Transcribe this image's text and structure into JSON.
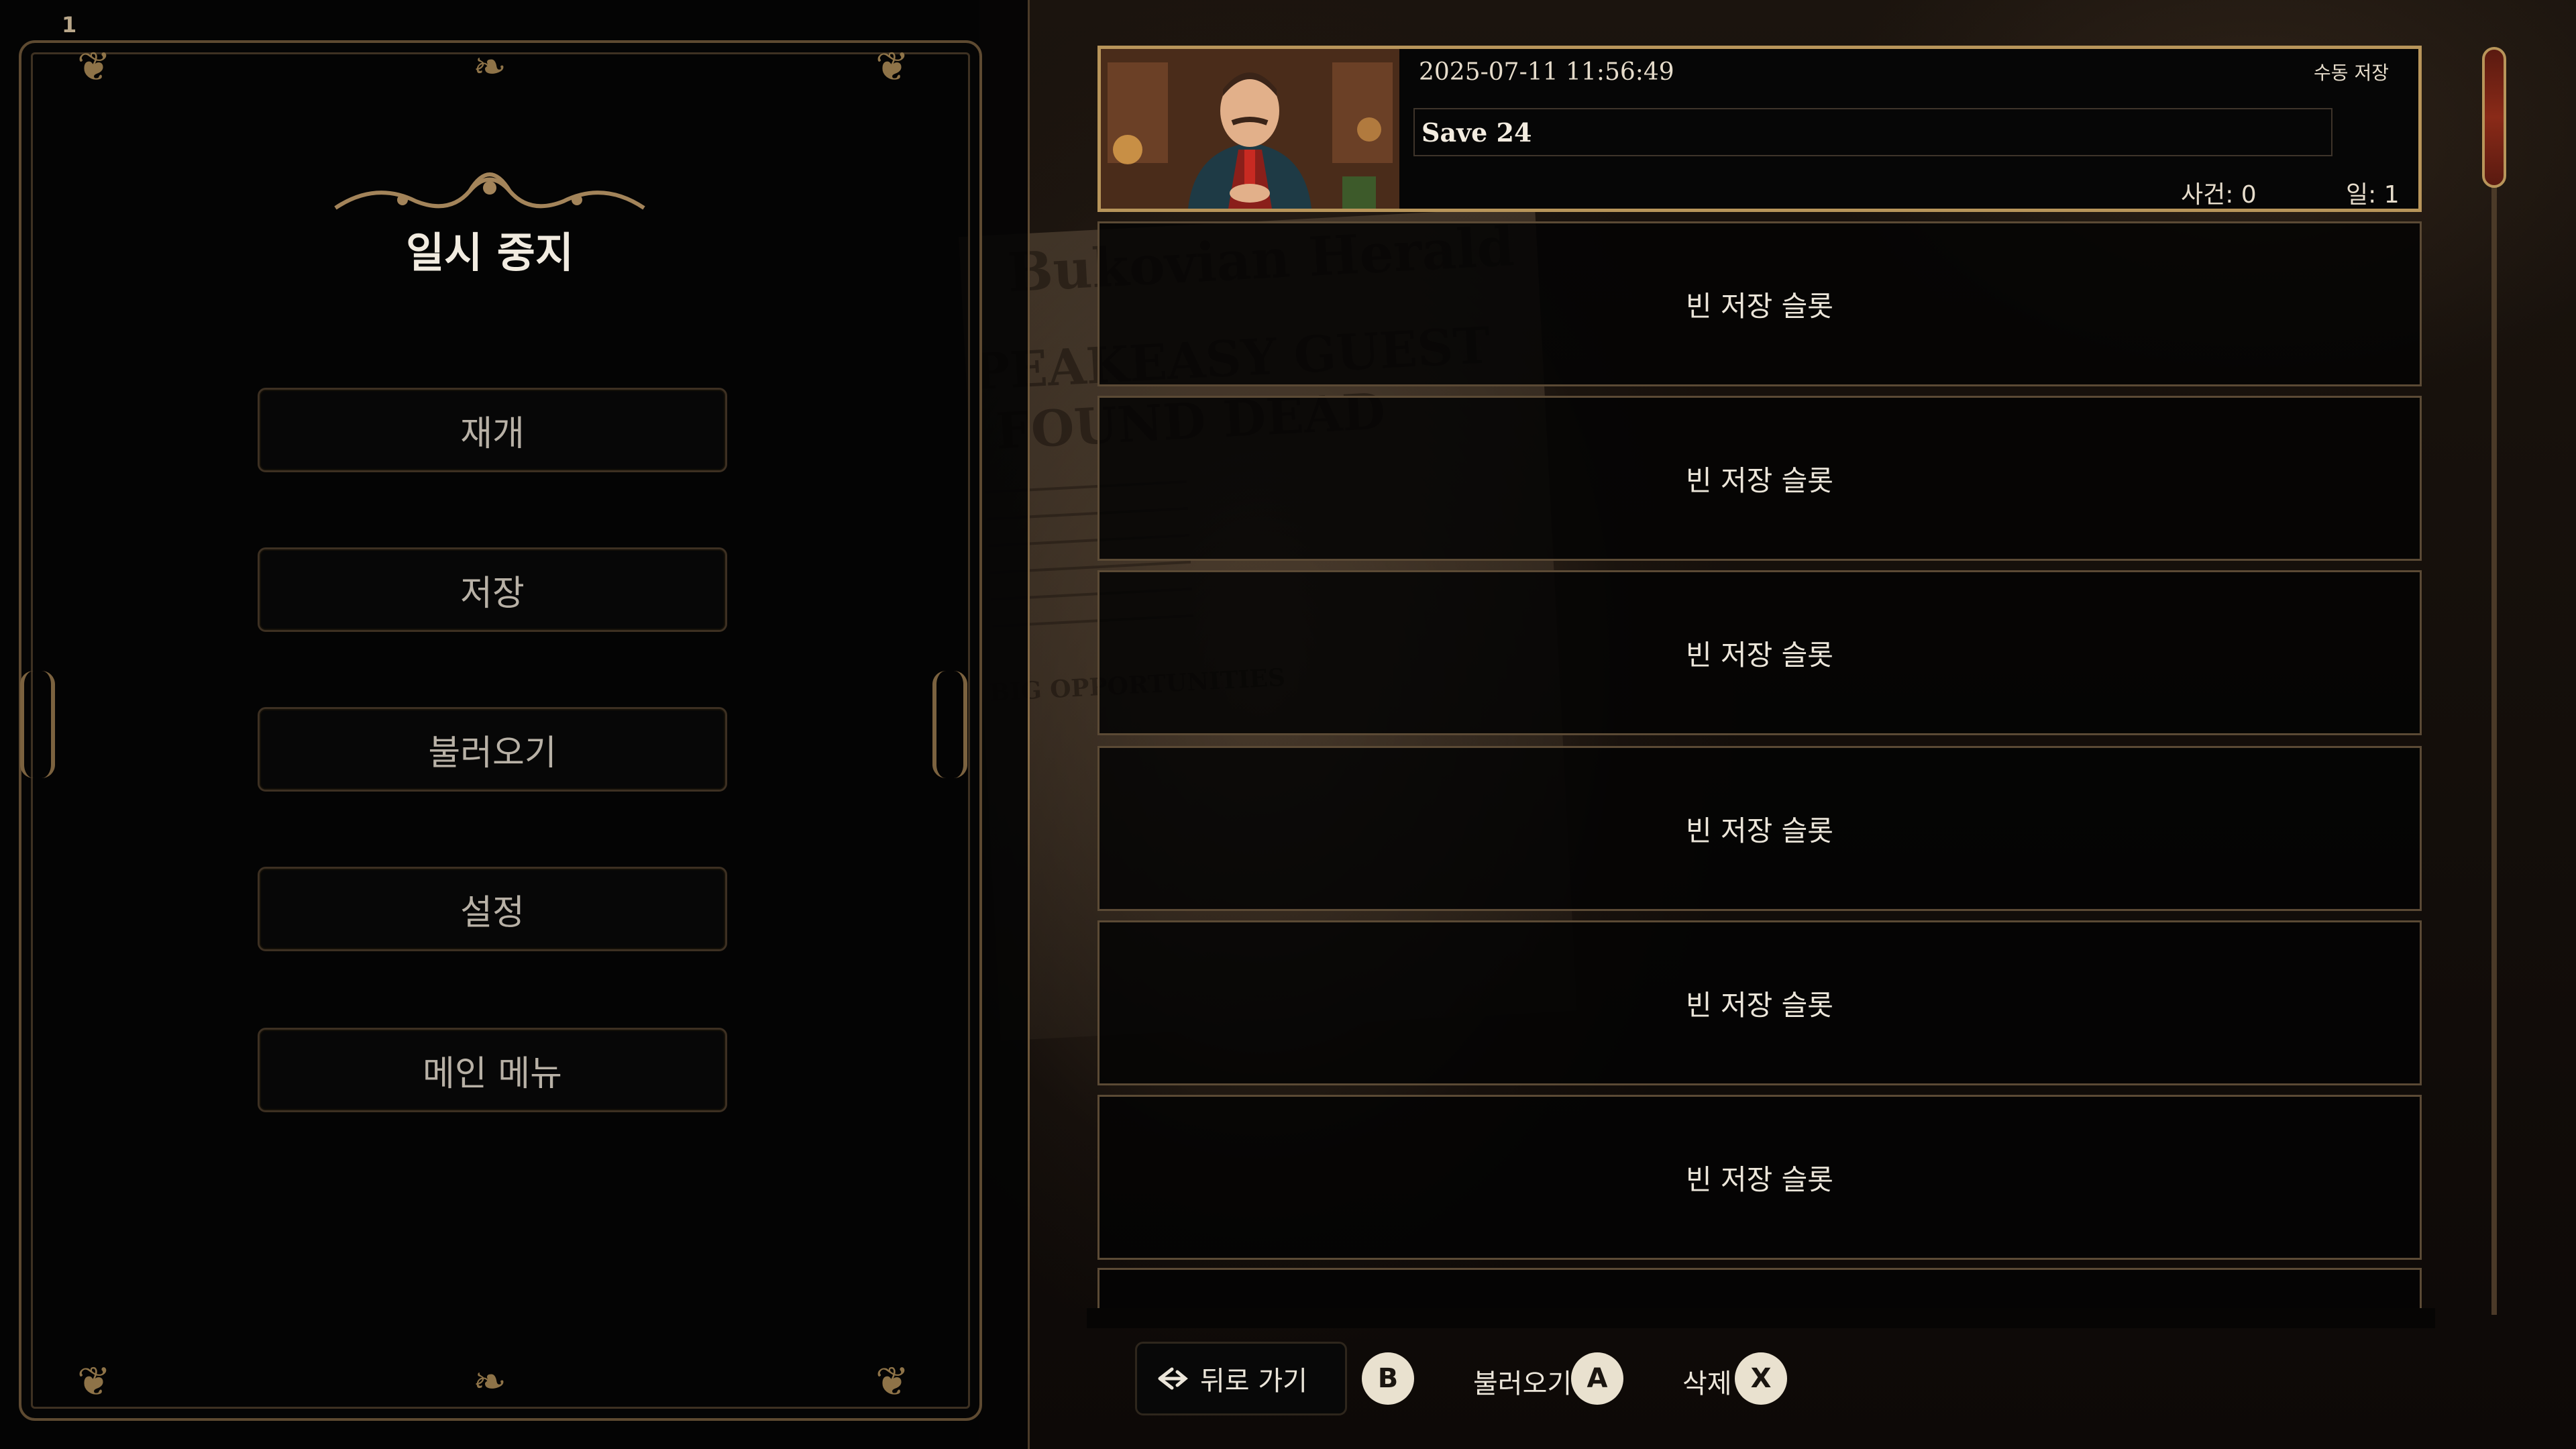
{
  "hud": {
    "tab_number": "1"
  },
  "pause_menu": {
    "title": "일시 중지",
    "buttons": [
      {
        "label": "재개"
      },
      {
        "label": "저장"
      },
      {
        "label": "불러오기"
      },
      {
        "label": "설정"
      },
      {
        "label": "메인 메뉴"
      }
    ]
  },
  "save_list": {
    "filled_slot": {
      "date": "2025-07-11 11:56:49",
      "type": "수동 저장",
      "name": "Save 24",
      "cases": "사건: 0",
      "day": "일: 1"
    },
    "empty_slots": [
      {
        "label": "빈 저장 슬롯"
      },
      {
        "label": "빈 저장 슬롯"
      },
      {
        "label": "빈 저장 슬롯"
      },
      {
        "label": "빈 저장 슬롯"
      },
      {
        "label": "빈 저장 슬롯"
      },
      {
        "label": "빈 저장 슬롯"
      }
    ]
  },
  "background": {
    "newspaper_title": "Bukovian Herald",
    "headline_1": "PEAKEASY GUEST",
    "headline_2": "FOUND DEAD",
    "subhead": "BIG OPPORTUNITIES"
  },
  "hints": {
    "back": {
      "label": "뒤로 가기",
      "button": "B"
    },
    "load": {
      "label": "불러오기",
      "button": "A"
    },
    "delete": {
      "label": "삭제",
      "button": "X"
    }
  },
  "colors": {
    "frame_gold": "#b8955a",
    "panel_bg": "#060606",
    "text": "#ece6da"
  }
}
